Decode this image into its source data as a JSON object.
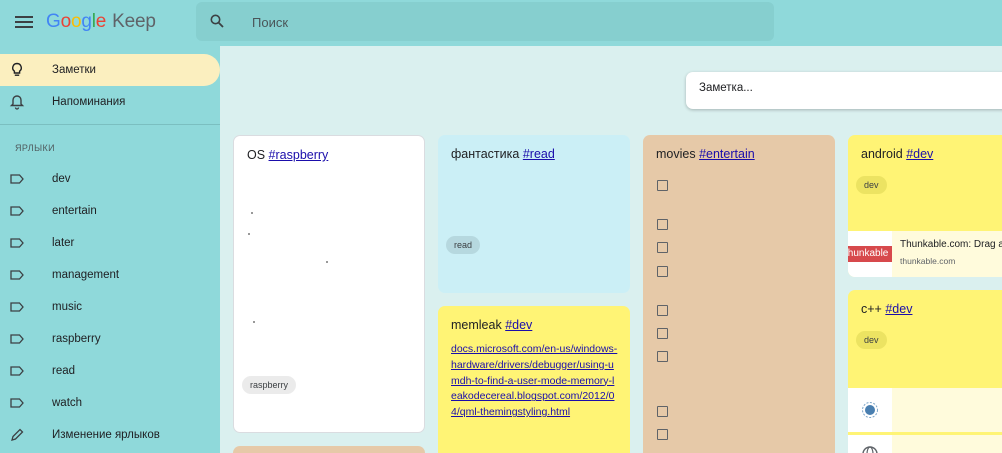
{
  "app": {
    "logo_letters": [
      "G",
      "o",
      "o",
      "g",
      "l",
      "e"
    ],
    "logo_product": "Keep"
  },
  "search": {
    "placeholder": "Поиск"
  },
  "sidebar": {
    "items": [
      {
        "label": "Заметки",
        "icon": "lightbulb-icon"
      },
      {
        "label": "Напоминания",
        "icon": "bell-icon"
      }
    ],
    "labels_heading": "ЯРЛЫКИ",
    "labels": [
      "dev",
      "entertain",
      "later",
      "management",
      "music",
      "raspberry",
      "read",
      "watch"
    ],
    "edit_labels": "Изменение ярлыков"
  },
  "note_input": {
    "placeholder": "Заметка..."
  },
  "notes": {
    "os": {
      "title": "OS",
      "tag_link": "#raspberry",
      "chip": "raspberry"
    },
    "fantastika": {
      "title": "фантастика",
      "tag_link": "#read",
      "chip": "read"
    },
    "memleak": {
      "title": "memleak",
      "tag_link": "#dev",
      "link_text": "docs.microsoft.com/en-us/windows-hardware/drivers/debugger/using-umdh-to-find-a-user-mode-memory-leakodecereal.blogspot.com/2012/04/qml-themingstyling.html"
    },
    "movies": {
      "title": "movies",
      "tag_link": "#entertain"
    },
    "android": {
      "title": "android",
      "tag_link": "#dev",
      "chip": "dev",
      "preview_image_text": "thunkable",
      "preview_title": "Thunkable.com: Drag a",
      "preview_domain": "thunkable.com"
    },
    "cpp": {
      "title": "c++",
      "tag_link": "#dev",
      "chip": "dev"
    }
  },
  "colors": {
    "header": "#8fd9da",
    "background": "#daf0ef",
    "active_nav": "#fbefbf",
    "note_white": "#ffffff",
    "note_blue": "#cbeff6",
    "note_yellow": "#fff475",
    "note_brown": "#e6c9a8"
  }
}
